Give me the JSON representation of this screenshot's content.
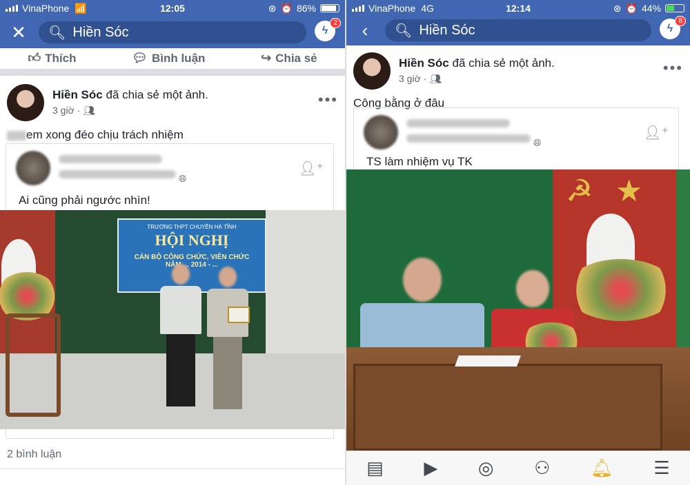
{
  "left": {
    "status": {
      "carrier": "VinaPhone",
      "time": "12:05",
      "battery": "86%",
      "battery_level": 0.86
    },
    "search": {
      "query": "Hiền Sóc"
    },
    "messenger_badge": "2",
    "top_actions": {
      "like": "Thích",
      "comment": "Bình luận",
      "share": "Chia sẻ"
    },
    "post": {
      "author": "Hiền Sóc",
      "action": "đã chia sẻ một ảnh.",
      "time": "3 giờ",
      "text": "em xong đéo chịu trách nhiệm",
      "shared_text": "Ai cũng phải ngước nhìn!",
      "banner": {
        "school": "TRƯỜNG THPT CHUYÊN HÀ TĨNH",
        "title": "HỘI NGHỊ",
        "line1": "CÁN BỘ CÔNG CHỨC, VIÊN CHỨC",
        "line2": "NĂM ... 2014 - ..."
      },
      "comments": "2 bình luận"
    },
    "icons": [
      "close-icon",
      "search-icon",
      "messenger-icon",
      "like-icon",
      "comment-icon",
      "share-icon",
      "more-icon",
      "people-icon",
      "globe-icon",
      "add-friend-icon"
    ]
  },
  "right": {
    "status": {
      "carrier": "VinaPhone",
      "network": "4G",
      "time": "12:14",
      "battery": "44%",
      "battery_level": 0.44
    },
    "search": {
      "query": "Hiền Sóc"
    },
    "messenger_badge": "8",
    "post": {
      "author": "Hiền Sóc",
      "action": "đã chia sẻ một ảnh.",
      "time": "3 giờ",
      "text": "Công bằng ở đâu",
      "shared_text": "TS làm nhiệm vụ TK"
    },
    "tabbar": [
      "news-feed-icon",
      "watch-icon",
      "profile-icon",
      "groups-icon",
      "notifications-icon",
      "menu-icon"
    ]
  }
}
